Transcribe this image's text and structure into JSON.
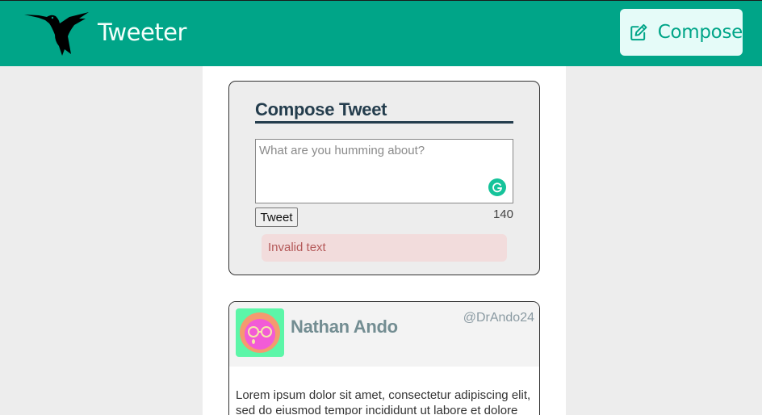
{
  "header": {
    "brand": "Tweeter",
    "compose_label": "Compose"
  },
  "compose": {
    "title": "Compose Tweet",
    "placeholder": "What are you humming about?",
    "tweet_button": "Tweet",
    "counter": "140",
    "error": "Invalid text"
  },
  "tweet": {
    "name": "Nathan Ando",
    "handle": "@DrAndo24",
    "text": "Lorem ipsum dolor sit amet, consectetur adipiscing elit, sed do eiusmod tempor incididunt ut labore et dolore"
  },
  "colors": {
    "accent": "#00a588",
    "error_text": "#b45858",
    "error_bg": "#f2dcdc"
  }
}
